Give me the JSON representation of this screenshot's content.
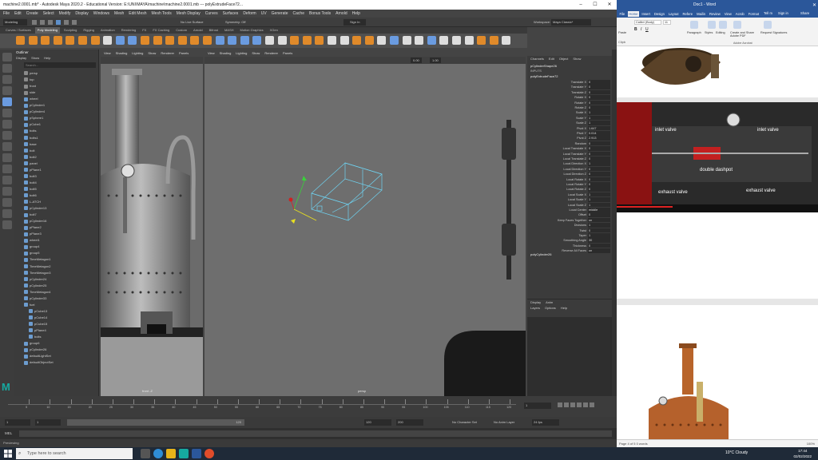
{
  "maya": {
    "title": "machine2.0001.mb* - Autodesk Maya 2020.2 - Educational Version: E:\\UNI\\MAYA\\machine\\machine2.0001.mb  ---  polyExtrudeFace72...",
    "menus": [
      "File",
      "Edit",
      "Create",
      "Select",
      "Modify",
      "Display",
      "Windows",
      "Mesh",
      "Edit Mesh",
      "Mesh Tools",
      "Mesh Display",
      "Curves",
      "Surfaces",
      "Deform",
      "UV",
      "Generate",
      "Cache",
      "Bonus Tools",
      "Arnold",
      "Help"
    ],
    "workspace_label": "Workspace:",
    "workspace_value": "Maya Classic*",
    "mode": "Modeling",
    "no_live_surface": "No Live Surface",
    "symmetry": "Symmetry: Off",
    "sign_in": "Sign In",
    "shelf_tabs": [
      "Curves / Surfaces",
      "Poly Modeling",
      "Sculpting",
      "Rigging",
      "Animation",
      "Rendering",
      "FX",
      "FX Caching",
      "Custom",
      "Arnold",
      "Bifrost",
      "MASH",
      "Motion Graphics",
      "XGen"
    ],
    "shelf_active": 1,
    "outliner": {
      "title": "Outliner",
      "menus": [
        "Display",
        "Show",
        "Help"
      ],
      "search_placeholder": "Search...",
      "items": [
        "persp",
        "top",
        "front",
        "side",
        "wheel",
        "pCylinder1",
        "pCylinder4",
        "pSphere1",
        "pCube1",
        "bolts",
        "bolts1",
        "base",
        "bolt",
        "bolt2",
        "panel",
        "pPlane1",
        "bolt3",
        "bolt4",
        "bolt5",
        "bolt6",
        "L-ATCH",
        "pCylinder13",
        "bolt7",
        "pCylinder16",
        "pPlane2",
        "pPlane3",
        "wheel1",
        "group4",
        "group5",
        "TimeMetagon1",
        "TimeMetagon2",
        "TimeMetagon3",
        "pCylinder24",
        "pCylinder25",
        "TimeMetagon4",
        "pCylinder33",
        "fuel",
        "pCube13",
        "pCube14",
        "pCube15",
        "pPlane4",
        "bolts",
        "group6",
        "pCylinder26",
        "defaultLightSet",
        "defaultObjectSet"
      ]
    },
    "viewport_menus": [
      "View",
      "Shading",
      "Lighting",
      "Show",
      "Renderer",
      "Panels"
    ],
    "viewport_left_label": "front -Z",
    "viewport_right_label": "persp",
    "vp_num1": "0.00",
    "vp_num2": "1.00",
    "channel_box": {
      "menus": [
        "Channels",
        "Edit",
        "Object",
        "Show"
      ],
      "object": "pCylinderShape26",
      "inputs_label": "INPUTS",
      "node": "polyExtrudeFace72",
      "channels": [
        {
          "name": "Translate X",
          "value": "0"
        },
        {
          "name": "Translate Y",
          "value": "0"
        },
        {
          "name": "Translate Z",
          "value": "0"
        },
        {
          "name": "Rotate X",
          "value": "0"
        },
        {
          "name": "Rotate Y",
          "value": "0"
        },
        {
          "name": "Rotate Z",
          "value": "0"
        },
        {
          "name": "Scale X",
          "value": "1"
        },
        {
          "name": "Scale Y",
          "value": "1"
        },
        {
          "name": "Scale Z",
          "value": "1"
        },
        {
          "name": "Pivot X",
          "value": "1.647"
        },
        {
          "name": "Pivot Y",
          "value": "0.014"
        },
        {
          "name": "Pivot Z",
          "value": "2.913"
        },
        {
          "name": "Random",
          "value": "0"
        },
        {
          "name": "Local Translate X",
          "value": "0"
        },
        {
          "name": "Local Translate Y",
          "value": "0"
        },
        {
          "name": "Local Translate Z",
          "value": "0"
        },
        {
          "name": "Local Direction X",
          "value": "1"
        },
        {
          "name": "Local Direction Y",
          "value": "0"
        },
        {
          "name": "Local Direction Z",
          "value": "0"
        },
        {
          "name": "Local Rotate X",
          "value": "0"
        },
        {
          "name": "Local Rotate Y",
          "value": "0"
        },
        {
          "name": "Local Rotate Z",
          "value": "0"
        },
        {
          "name": "Local Scale X",
          "value": "1"
        },
        {
          "name": "Local Scale Y",
          "value": "1"
        },
        {
          "name": "Local Scale Z",
          "value": "1"
        },
        {
          "name": "Local Center",
          "value": "middle"
        },
        {
          "name": "Offset",
          "value": "0"
        },
        {
          "name": "Keep Faces Together",
          "value": "on"
        },
        {
          "name": "Divisions",
          "value": "1"
        },
        {
          "name": "Twist",
          "value": "0"
        },
        {
          "name": "Taper",
          "value": "1"
        },
        {
          "name": "Smoothing Angle",
          "value": "30"
        },
        {
          "name": "Thickness",
          "value": "0"
        },
        {
          "name": "Reverse All Faces",
          "value": "on"
        }
      ],
      "extra_node": "polyCylinder26"
    },
    "layers": {
      "tabs": [
        "Display",
        "Anim"
      ],
      "menus": [
        "Layers",
        "Options",
        "Help"
      ]
    },
    "timeline_ticks": [
      "5",
      "10",
      "15",
      "20",
      "25",
      "30",
      "35",
      "40",
      "45",
      "50",
      "55",
      "60",
      "65",
      "70",
      "75",
      "80",
      "85",
      "90",
      "95",
      "100",
      "105",
      "110",
      "115",
      "120"
    ],
    "current_frame": "1",
    "range": {
      "start": "1",
      "start2": "1",
      "mid": "120",
      "end": "120",
      "end2": "200"
    },
    "no_char_set": "No Character Set",
    "no_anim_layer": "No Anim Layer",
    "fps": "24 fps",
    "mel": "MEL",
    "help_line": "Previewing"
  },
  "word": {
    "title": "Doc1 - Word",
    "tabs": [
      "File",
      "Home",
      "Insert",
      "Design",
      "Layout",
      "Refere",
      "Mailin",
      "Review",
      "View",
      "Acrob",
      "Format"
    ],
    "tell_me": "Tell m",
    "sign_in": "Sign in",
    "share": "Share",
    "font_name": "Calibri (Body)",
    "font_size": "11",
    "ribbon_groups": [
      "Paragraph",
      "Styles",
      "Editing",
      "Create and Share Adobe PDF",
      "Request Signatures"
    ],
    "adobe_acrobat": "Adobe Acrobat",
    "paste": "Paste",
    "clipboard": "Clipb",
    "video_labels": [
      "inlet valve",
      "inlet valve",
      "double dashpot",
      "exhaust valve",
      "exhaust valve"
    ],
    "status": "Page 4 of 5   0 words",
    "zoom": "100%"
  },
  "taskbar": {
    "search_placeholder": "Type here to search",
    "weather": "10°C  Cloudy",
    "time": "17:44",
    "date": "02/02/2022"
  }
}
